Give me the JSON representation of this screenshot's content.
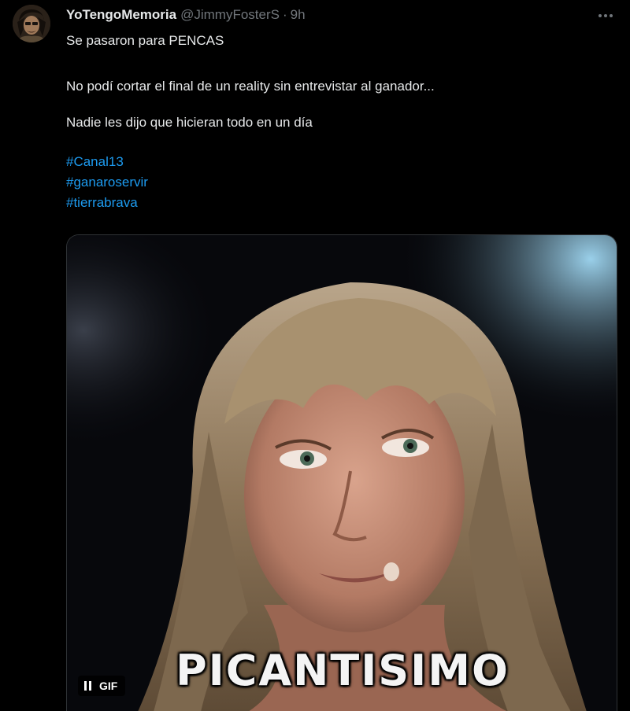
{
  "tweet": {
    "author": {
      "display_name": "YoTengoMemoria",
      "handle": "@JimmyFosterS",
      "separator": "·",
      "time": "9h"
    },
    "body_lines": [
      "Se pasaron para PENCAS",
      "No podí cortar el final de un reality sin entrevistar al ganador...",
      "Nadie les dijo que hicieran todo en un día"
    ],
    "hashtags": [
      "#Canal13",
      "#ganaroservir",
      "#tierrabrava"
    ],
    "media": {
      "type": "gif",
      "caption": "PICANTISIMO",
      "badge_label": "GIF"
    }
  },
  "icons": {
    "more": "more-horizontal-icon",
    "pause": "pause-icon"
  },
  "colors": {
    "background": "#000000",
    "text": "#e7e9ea",
    "muted": "#71767b",
    "accent": "#1d9bf0"
  }
}
